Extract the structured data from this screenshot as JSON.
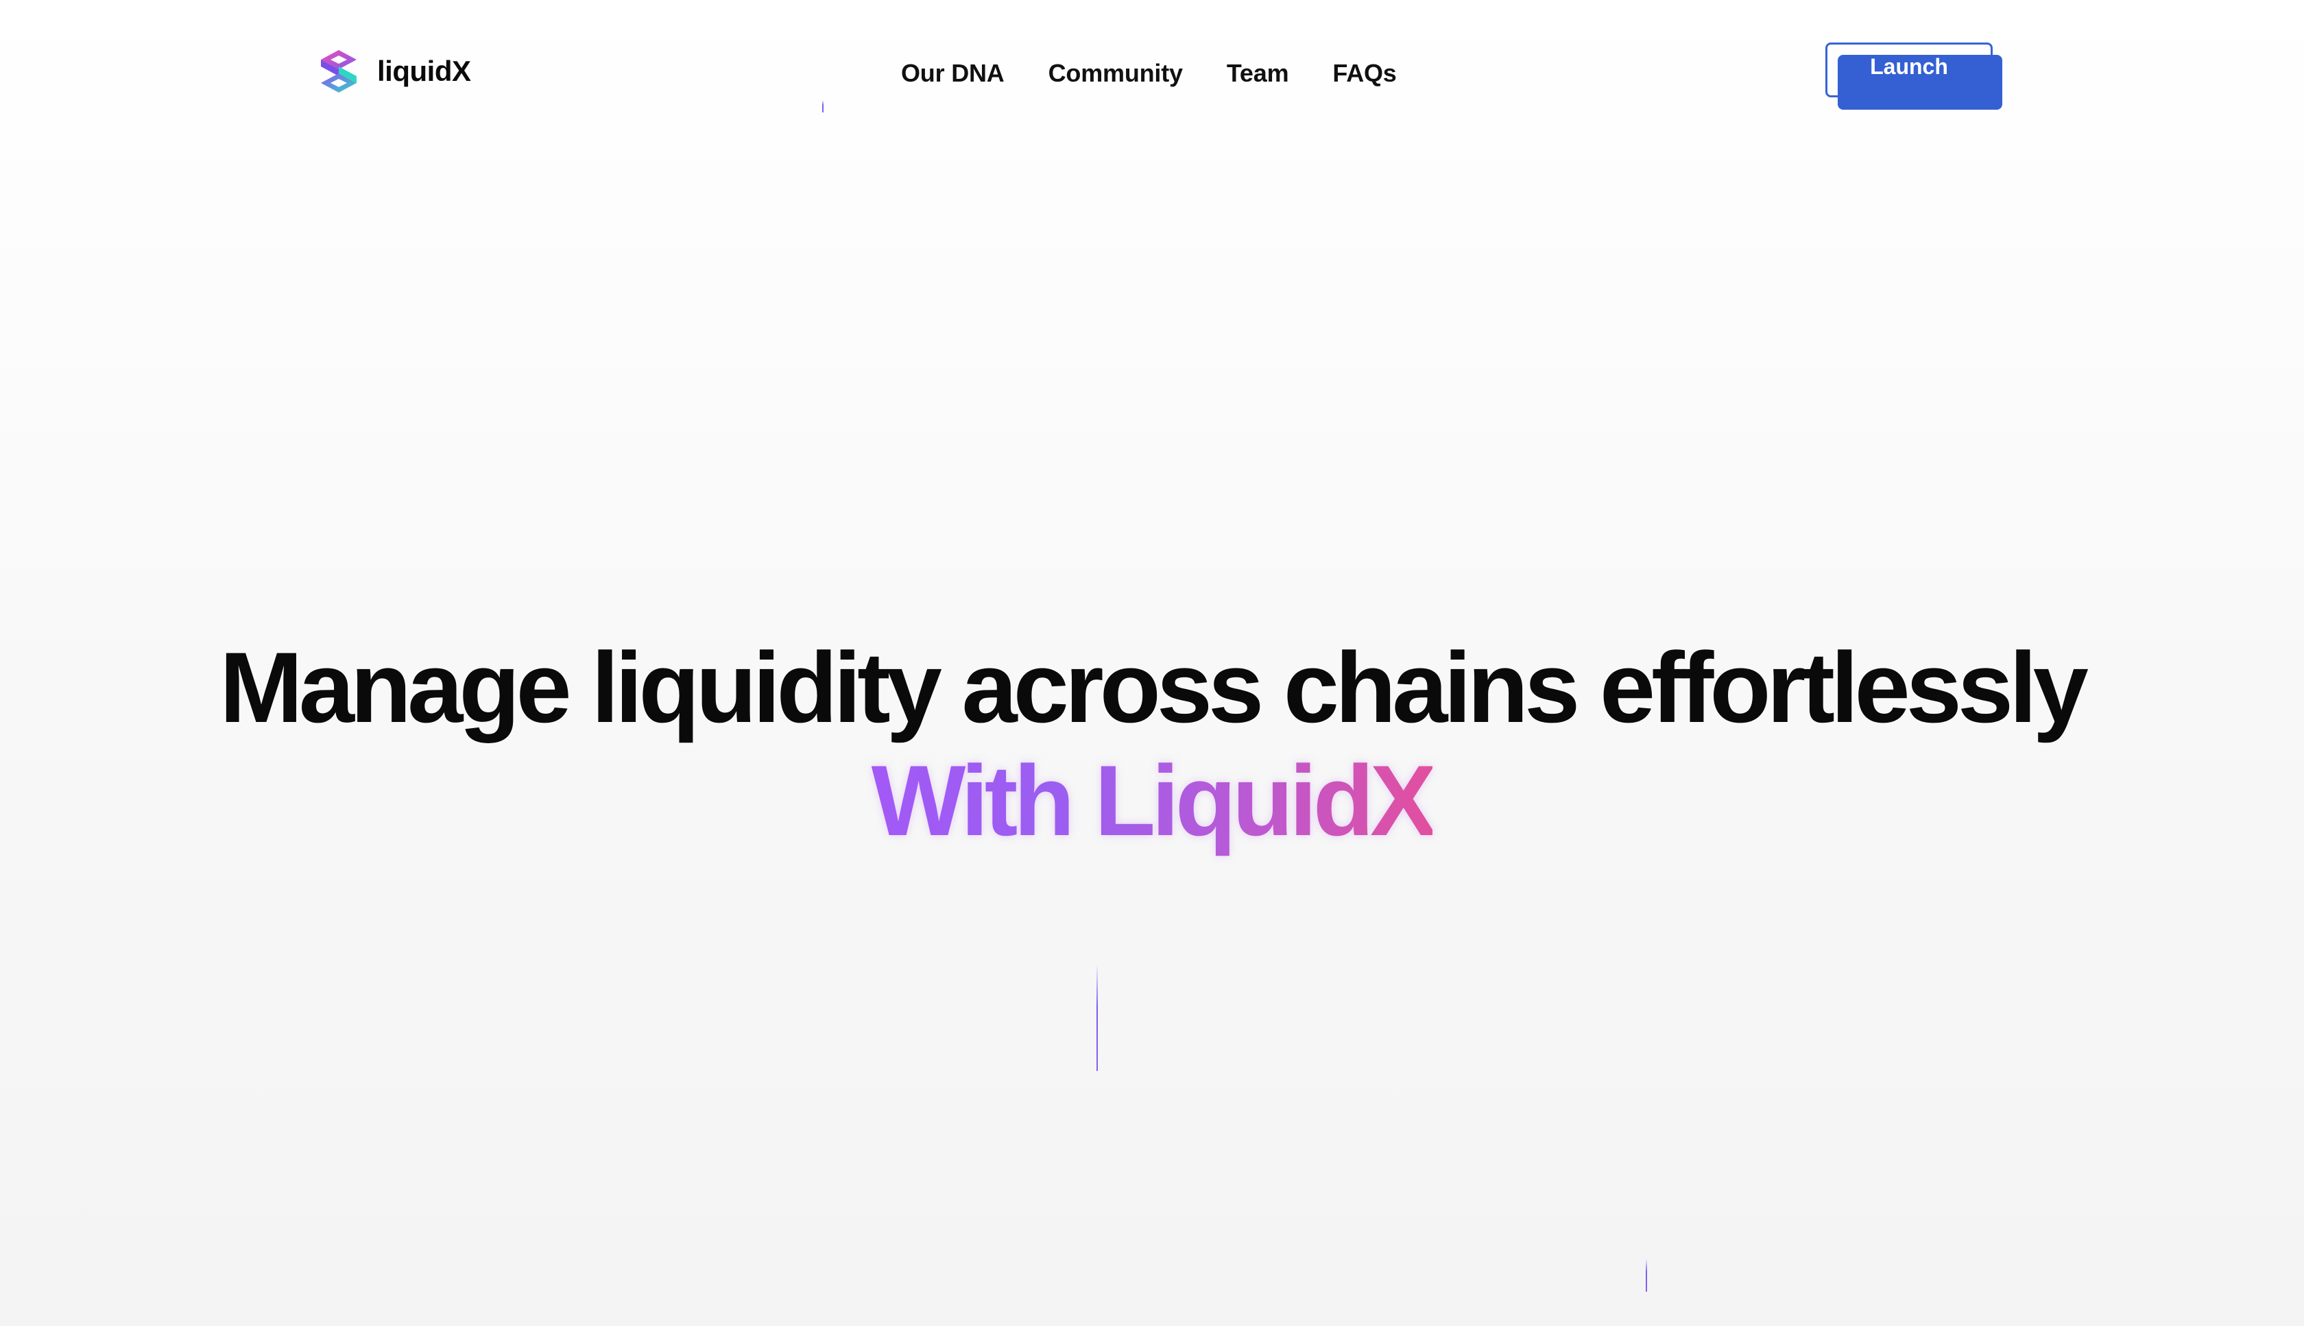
{
  "brand": {
    "name": "liquidX",
    "logo_icon": "liquidx-hex-logo-icon",
    "colors": {
      "pink": "#e84fb3",
      "purple": "#8a58f0",
      "teal": "#2fd6c3"
    }
  },
  "nav": {
    "items": [
      {
        "label": "Our DNA"
      },
      {
        "label": "Community"
      },
      {
        "label": "Team"
      },
      {
        "label": "FAQs"
      }
    ]
  },
  "header": {
    "launch_label": "Launch",
    "launch_color": "#3560d3"
  },
  "hero": {
    "title": "Manage liquidity across chains effortlessly",
    "subtitle": "With LiquidX",
    "subtitle_gradient": [
      "#a259f6",
      "#9b5ef0",
      "#b85ad6",
      "#e24f9e"
    ]
  },
  "decor": {
    "beam_color": "#7b5cf0"
  }
}
